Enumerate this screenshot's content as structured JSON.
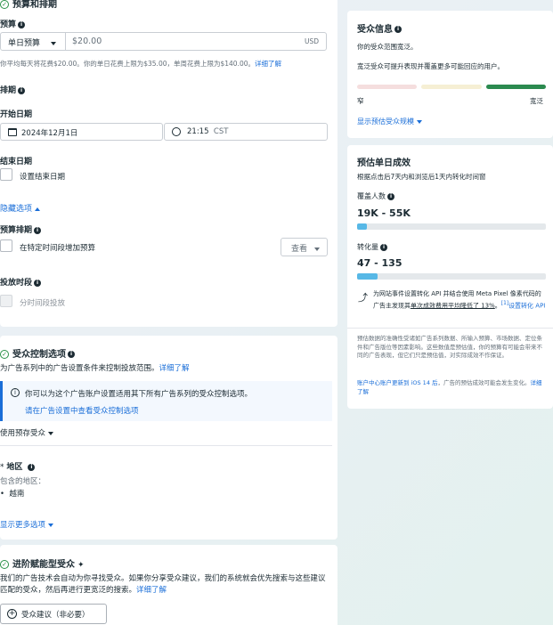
{
  "budget_section": {
    "title": "预算和排期",
    "budget_label": "预算",
    "budget_type": "单日预算",
    "budget_value": "$20.00",
    "currency": "USD",
    "budget_note": "你平均每天将花费$20.00。你的单日花费上限为$35.00，单周花费上限为$140.00。",
    "learn_more": "详细了解",
    "schedule_label": "排期",
    "start_date_label": "开始日期",
    "start_date": "2024年12月1日",
    "start_time": "21:15",
    "timezone": "CST",
    "end_date_label": "结束日期",
    "end_date_checkbox": "设置结束日期",
    "hide_options": "隐藏选项",
    "budget_schedule_label": "预算排期",
    "budget_schedule_checkbox": "在特定时间段增加预算",
    "view_button": "查看",
    "delivery_label": "投放时段",
    "delivery_checkbox": "分时间段投放"
  },
  "audience_controls": {
    "title": "受众控制选项",
    "desc": "为广告系列中的广告设置条件来控制投放范围。",
    "learn_more": "详细了解",
    "notice": "你可以为这个广告账户设置适用其下所有广告系列的受众控制选项。",
    "notice_link": "请在广告设置中查看受众控制选项",
    "saved_audience": "使用预存受众",
    "location_label": "地区",
    "include_label": "包含的地区：",
    "location_item": "越南",
    "show_more": "显示更多选项"
  },
  "advantage": {
    "title": "进阶赋能型受众",
    "desc": "我们的广告技术会自动为你寻找受众。如果你分享受众建议，我们的系统就会优先搜索与这些建议匹配的受众，然后再进行更宽泛的搜索。",
    "learn_more": "详细了解",
    "suggest_button": "受众建议（非必要）"
  },
  "audience_info": {
    "title": "受众信息",
    "range_text": "你的受众范围宽泛。",
    "tip": "宽泛受众可提升表现并覆盖更多可能回应的用户。",
    "narrow": "窄",
    "broad": "宽泛",
    "show_estimate": "显示预估受众规模"
  },
  "estimates": {
    "title": "预估单日成效",
    "subtitle": "根据点击后7天内和浏览后1天内转化时间窗",
    "reach_label": "覆盖人数",
    "reach_value": "19K - 55K",
    "reach_fill": 0.05,
    "conv_label": "转化量",
    "conv_value": "47 - 135",
    "conv_fill": 0.11,
    "pixel_note_a": "为网站事件设置转化 API 并结合使用 Meta Pixel 像素代码的广告主发现其",
    "pixel_note_link": "单次成效费用平均降低了 13%",
    "pixel_note_b": "。",
    "pixel_note_ref": "[1]",
    "pixel_setup": "设置转化 API",
    "accuracy": "预估数据的准确性受诸如广告系列数据、所输入预算、市场数据、定位条件和广告版位等因素影响。这些数值是预估值，你的预算有可能会带来不同的广告表现，但它们只是预估值，对实际成效不作保证。",
    "ios_link": "账户中心账户更新到 iOS 14 后",
    "ios_note": "，广告的预估成效可能会发生变化。",
    "ios_more": "详细了解"
  }
}
